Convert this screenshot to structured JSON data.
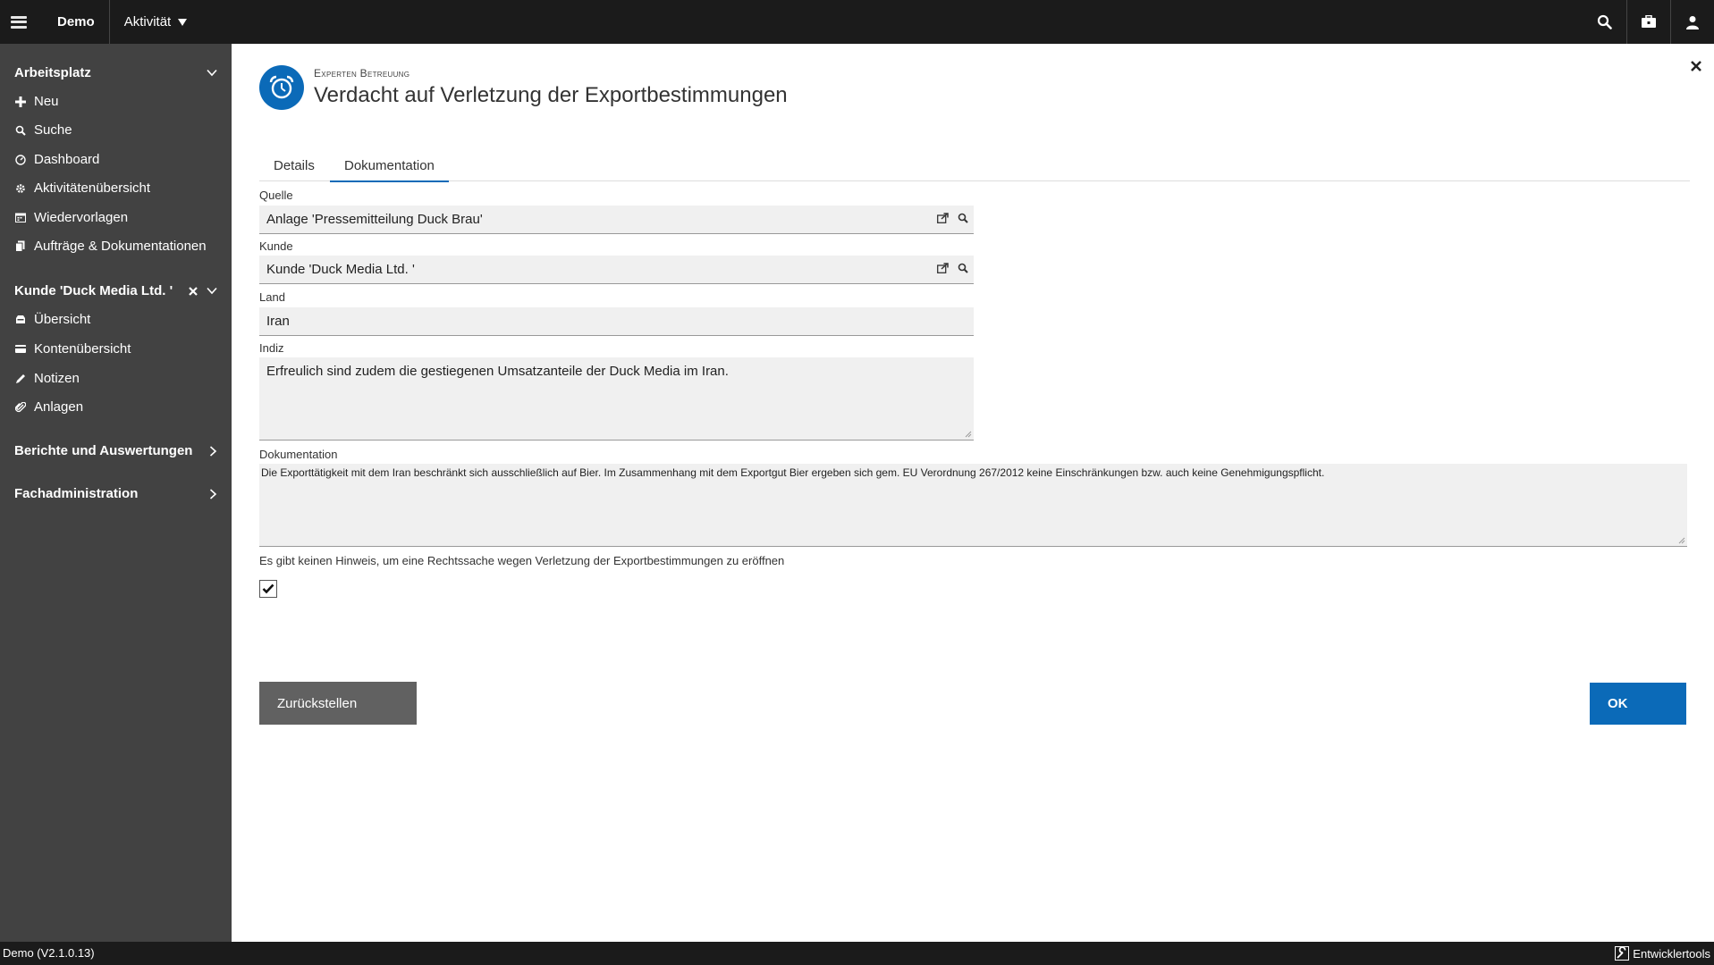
{
  "topbar": {
    "app_name": "Demo",
    "activity_menu": "Aktivität",
    "icons": [
      "search-icon",
      "briefcase-icon",
      "user-icon"
    ]
  },
  "sidebar": {
    "section1": {
      "title": "Arbeitsplatz",
      "items": [
        {
          "label": "Neu",
          "icon": "plus-icon"
        },
        {
          "label": "Suche",
          "icon": "search-icon"
        },
        {
          "label": "Dashboard",
          "icon": "gauge-icon"
        },
        {
          "label": "Aktivitätenübersicht",
          "icon": "gear-icon"
        },
        {
          "label": "Wiedervorlagen",
          "icon": "calendar-icon"
        },
        {
          "label": "Aufträge & Dokumentationen",
          "icon": "documents-icon"
        }
      ]
    },
    "section2": {
      "title": "Kunde 'Duck Media Ltd. '",
      "items": [
        {
          "label": "Übersicht",
          "icon": "overview-icon"
        },
        {
          "label": "Kontenübersicht",
          "icon": "credit-card-icon"
        },
        {
          "label": "Notizen",
          "icon": "pencil-icon"
        },
        {
          "label": "Anlagen",
          "icon": "paperclip-icon"
        }
      ]
    },
    "section3": {
      "title": "Berichte und Auswertungen"
    },
    "section4": {
      "title": "Fachadministration"
    }
  },
  "header": {
    "subtitle": "Experten Betreuung",
    "title": "Verdacht auf Verletzung der Exportbestimmungen",
    "icon": "alarm-clock-icon"
  },
  "tabs": [
    {
      "label": "Details",
      "active": false
    },
    {
      "label": "Dokumentation",
      "active": true
    }
  ],
  "form": {
    "quelle": {
      "label": "Quelle",
      "value": "Anlage 'Pressemitteilung Duck Brau'"
    },
    "kunde": {
      "label": "Kunde",
      "value": "Kunde 'Duck Media Ltd. '"
    },
    "land": {
      "label": "Land",
      "value": "Iran"
    },
    "indiz": {
      "label": "Indiz",
      "value": "Erfreulich sind zudem die gestiegenen Umsatzanteile der Duck Media im Iran."
    },
    "dokumentation": {
      "label": "Dokumentation",
      "value": "Die Exporttätigkeit mit dem Iran beschränkt sich ausschließlich auf Bier. Im Zusammenhang mit dem Exportgut Bier ergeben sich gem. EU Verordnung 267/2012 keine Einschränkungen bzw. auch keine Genehmigungspflicht."
    },
    "hint": "Es gibt keinen Hinweis, um eine Rechtssache wegen Verletzung der Exportbestimmungen zu eröffnen",
    "checkbox_checked": true
  },
  "buttons": {
    "back": "Zurückstellen",
    "ok": "OK"
  },
  "footer": {
    "version": "Demo (V2.1.0.13)",
    "devtools": "Entwicklertools"
  },
  "colors": {
    "accent": "#0b6ab8",
    "sidebar_bg": "#424242",
    "topbar_bg": "#1b1b1b"
  }
}
